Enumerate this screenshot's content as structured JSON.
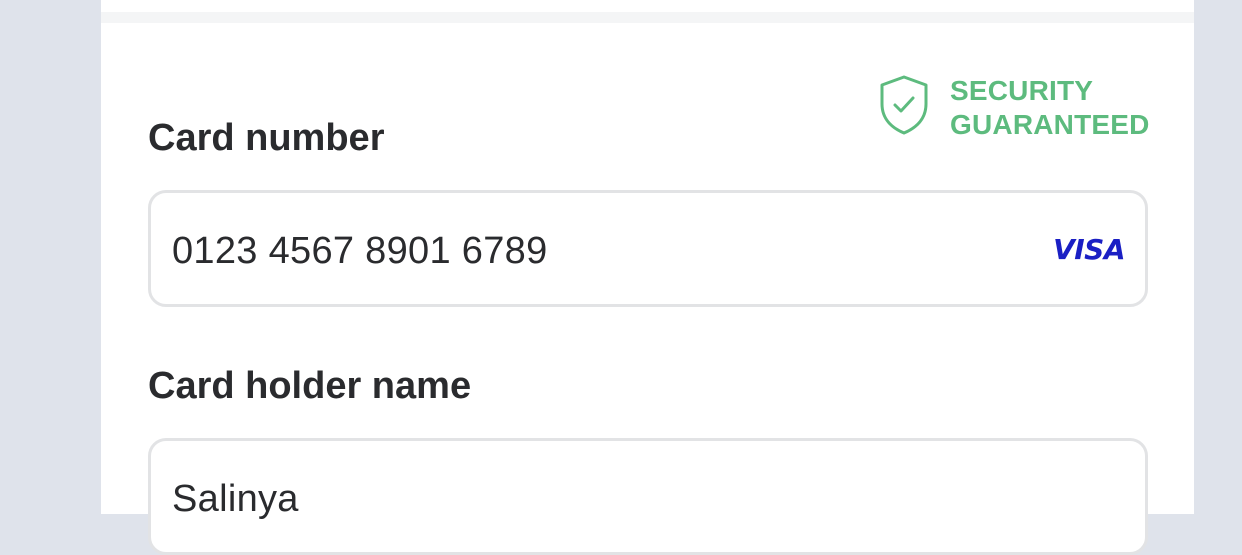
{
  "security": {
    "line1": "SECURITY",
    "line2": "GUARANTEED",
    "icon": "shield-check-icon",
    "color": "#5dbb7e"
  },
  "card_number": {
    "label": "Card number",
    "value": "0123 4567 8901 6789",
    "brand": "VISA",
    "brand_color": "#1a1fc4"
  },
  "card_holder": {
    "label": "Card holder name",
    "value": "Salinya"
  }
}
